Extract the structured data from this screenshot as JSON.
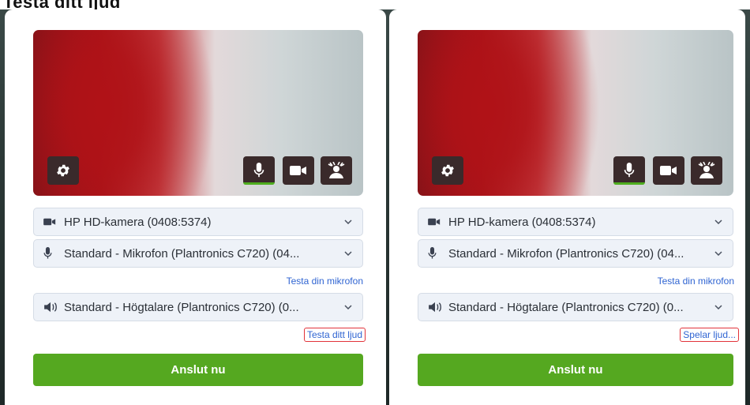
{
  "heading_cut": "Testa ditt ljud",
  "panels": [
    {
      "camera_select": "HP HD-kamera (0408:5374)",
      "mic_select": "Standard - Mikrofon (Plantronics C720) (04...",
      "test_mic_link": "Testa din mikrofon",
      "speaker_select": "Standard - Högtalare (Plantronics C720) (0...",
      "sound_link": "Testa ditt ljud",
      "connect_button": "Anslut nu"
    },
    {
      "camera_select": "HP HD-kamera (0408:5374)",
      "mic_select": "Standard - Mikrofon (Plantronics C720) (04...",
      "test_mic_link": "Testa din mikrofon",
      "speaker_select": "Standard - Högtalare (Plantronics C720) (0...",
      "sound_link": "Spelar ljud...",
      "connect_button": "Anslut nu"
    }
  ],
  "icons": {
    "settings": "gear-icon",
    "microphone": "microphone-icon",
    "camera": "video-camera-icon",
    "background": "background-effects-icon",
    "speaker": "speaker-icon",
    "chevron": "chevron-down-icon"
  },
  "colors": {
    "connect_button": "#55a820",
    "mic_level": "#4fae1f",
    "link": "#2f64d2",
    "highlight_box": "#e2333a",
    "preview_control_bg": "#3a2a2b"
  }
}
